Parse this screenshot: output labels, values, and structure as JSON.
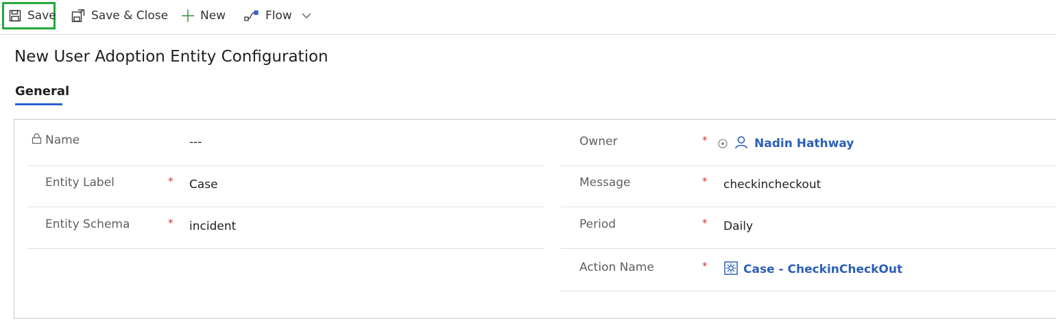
{
  "toolbar": {
    "save_label": "Save",
    "save_close_label": "Save & Close",
    "new_label": "New",
    "flow_label": "Flow"
  },
  "page": {
    "title": "New User Adoption Entity Configuration"
  },
  "tabs": [
    {
      "label": "General",
      "selected": true
    }
  ],
  "form": {
    "left": [
      {
        "label": "Name",
        "value": "---",
        "required": false,
        "locked": true
      },
      {
        "label": "Entity Label",
        "value": "Case",
        "required": true
      },
      {
        "label": "Entity Schema",
        "value": "incident",
        "required": true
      }
    ],
    "right": [
      {
        "label": "Owner",
        "value": "Nadin Hathway",
        "required": true,
        "type": "user-lookup"
      },
      {
        "label": "Message",
        "value": "checkincheckout",
        "required": true
      },
      {
        "label": "Period",
        "value": "Daily",
        "required": true
      },
      {
        "label": "Action Name",
        "value": "Case - CheckinCheckOut",
        "required": true,
        "type": "entity-lookup"
      }
    ],
    "required_marker": "*"
  },
  "colors": {
    "accent": "#2b5fce",
    "link": "#2b5fb8",
    "required": "#d13438",
    "highlight_box": "#22a83a"
  }
}
